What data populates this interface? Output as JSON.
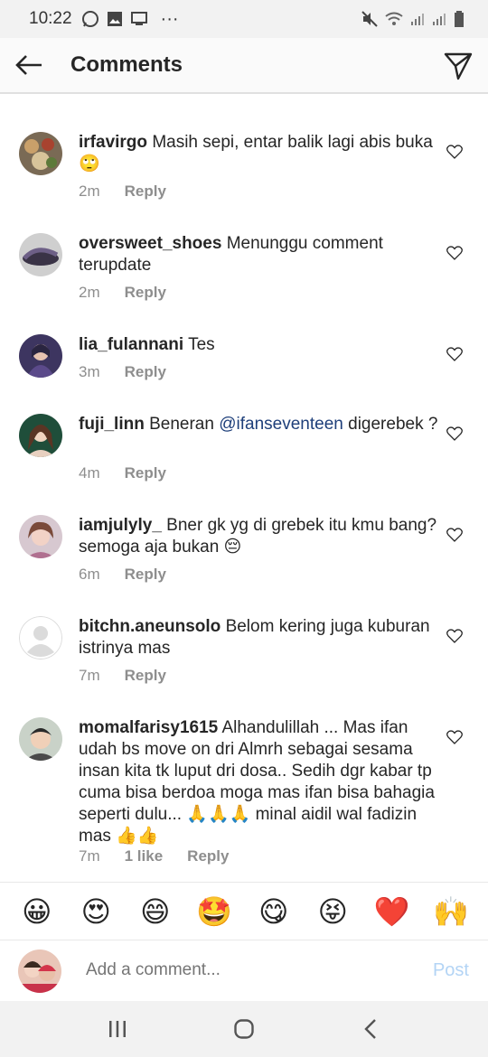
{
  "status_bar": {
    "time": "10:22",
    "more": "···"
  },
  "header": {
    "title": "Comments"
  },
  "comments": [
    {
      "username": "irfavirgo",
      "text": "Masih sepi, entar balik lagi abis buka 🙄",
      "time": "2m",
      "likes": "",
      "reply": "Reply"
    },
    {
      "username": "oversweet_shoes",
      "text": "Menunggu comment terupdate",
      "time": "2m",
      "likes": "",
      "reply": "Reply"
    },
    {
      "username": "lia_fulannani",
      "text": "Tes",
      "time": "3m",
      "likes": "",
      "reply": "Reply"
    },
    {
      "username": "fuji_linn",
      "text_before": "Beneran",
      "mention": "@ifanseventeen",
      "text_after": "digerebek ?",
      "time": "4m",
      "likes": "",
      "reply": "Reply"
    },
    {
      "username": "iamjulyly_",
      "text": "Bner gk yg di grebek itu kmu bang? semoga aja bukan 😔",
      "time": "6m",
      "likes": "",
      "reply": "Reply"
    },
    {
      "username": "bitchn.aneunsolo",
      "text": "Belom kering juga kuburan istrinya mas",
      "time": "7m",
      "likes": "",
      "reply": "Reply"
    },
    {
      "username": "momalfarisy1615",
      "text": "Alhandulillah ... Mas ifan udah bs move on dri Almrh sebagai sesama insan kita tk luput dri dosa.. Sedih dgr kabar tp cuma bisa berdoa moga mas ifan bisa bahagia seperti dulu... 🙏🙏🙏 minal aidil wal fadizin mas 👍👍",
      "time": "7m",
      "likes": "1 like",
      "reply": "Reply"
    }
  ],
  "emoji_bar": [
    "😀",
    "😍",
    "😄",
    "🤩",
    "😋",
    "😝",
    "❤️",
    "🙌"
  ],
  "composer": {
    "placeholder": "Add a comment...",
    "post_label": "Post"
  },
  "colors": {
    "accent_disabled": "#b3d4f5",
    "mention": "#1e3f7a",
    "meta": "#8e8e8e"
  }
}
